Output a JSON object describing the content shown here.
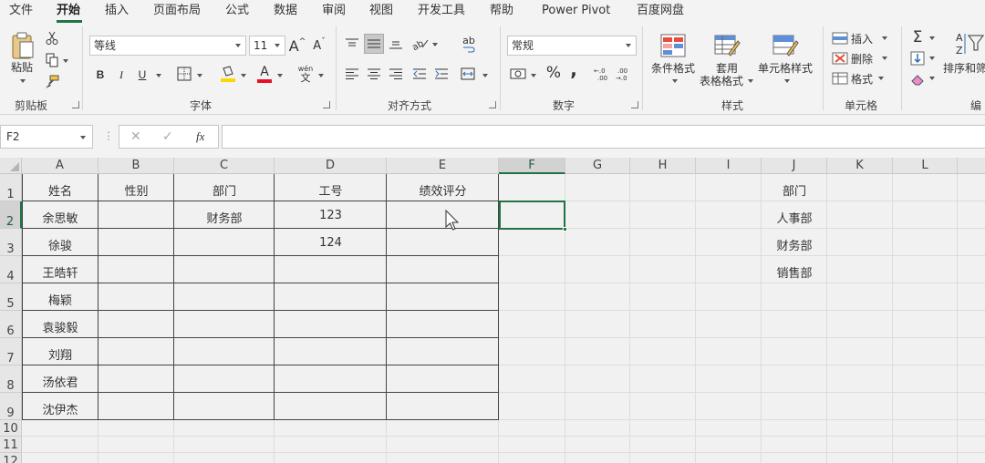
{
  "menu": {
    "tabs": [
      "文件",
      "开始",
      "插入",
      "页面布局",
      "公式",
      "数据",
      "审阅",
      "视图",
      "开发工具",
      "帮助",
      "Power Pivot",
      "百度网盘"
    ],
    "active": "开始"
  },
  "ribbon": {
    "clipboard": {
      "paste": "粘贴",
      "label": "剪贴板"
    },
    "font": {
      "name": "等线",
      "size": "11",
      "bold": "B",
      "italic": "I",
      "underline": "U",
      "grow": "A",
      "shrink": "A",
      "font_color": "A",
      "phonetic": "wén",
      "label": "字体"
    },
    "alignment": {
      "label": "对齐方式",
      "wrap": "ab"
    },
    "number": {
      "format": "常规",
      "percent": "%",
      "comma": ",",
      "label": "数字"
    },
    "styles": {
      "conditional": "条件格式",
      "table_line1": "套用",
      "table_line2": "表格格式",
      "cell_styles": "单元格样式",
      "label": "样式"
    },
    "cells": {
      "insert": "插入",
      "delete": "删除",
      "format": "格式",
      "label": "单元格"
    },
    "editing": {
      "sum": "Σ",
      "sort": "排序和筛",
      "label": "编"
    }
  },
  "formula_bar": {
    "name_box": "F2",
    "dots": "⋮",
    "cancel": "✕",
    "enter": "✓",
    "fx": "fx",
    "value": ""
  },
  "grid": {
    "columns": [
      "A",
      "B",
      "C",
      "D",
      "E",
      "F",
      "G",
      "H",
      "I",
      "J",
      "K",
      "L"
    ],
    "rows": [
      "1",
      "2",
      "3",
      "4",
      "5",
      "6",
      "7",
      "8",
      "9",
      "10",
      "11",
      "12"
    ],
    "selected_cell": "F2",
    "table_headers": [
      "姓名",
      "性别",
      "部门",
      "工号",
      "绩效评分"
    ],
    "table_rows": [
      [
        "余思敏",
        "",
        "财务部",
        "123",
        ""
      ],
      [
        "徐骏",
        "",
        "",
        "124",
        ""
      ],
      [
        "王皓轩",
        "",
        "",
        "",
        ""
      ],
      [
        "梅颖",
        "",
        "",
        "",
        ""
      ],
      [
        "袁骏毅",
        "",
        "",
        "",
        ""
      ],
      [
        "刘翔",
        "",
        "",
        "",
        ""
      ],
      [
        "汤依君",
        "",
        "",
        "",
        ""
      ],
      [
        "沈伊杰",
        "",
        "",
        "",
        ""
      ]
    ],
    "side_list": [
      "部门",
      "人事部",
      "财务部",
      "销售部"
    ]
  },
  "colors": {
    "accent": "#217346",
    "font_color_bar": "#e81123",
    "fill_color_bar": "#ffd700"
  }
}
